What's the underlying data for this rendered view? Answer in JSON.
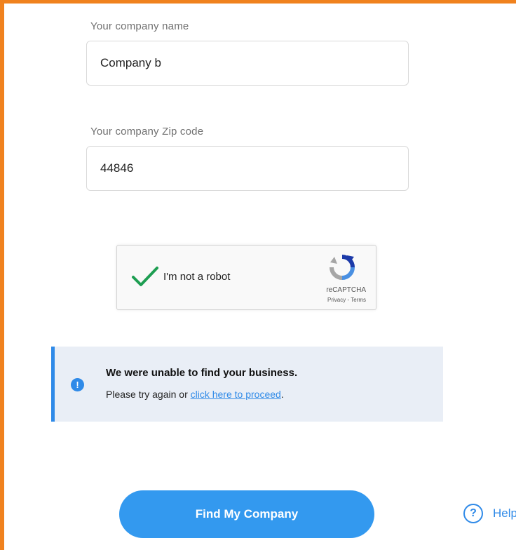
{
  "form": {
    "company_name": {
      "label": "Your company name",
      "value": "Company b"
    },
    "zip_code": {
      "label": "Your company Zip code",
      "value": "44846"
    }
  },
  "captcha": {
    "label": "I'm not a robot",
    "brand": "reCAPTCHA",
    "links": "Privacy - Terms",
    "checked": true
  },
  "alert": {
    "title": "We were unable to find your business.",
    "message_prefix": "Please try again or ",
    "link_text": "click here to proceed",
    "message_suffix": ".",
    "icon": "exclamation-icon"
  },
  "actions": {
    "find_label": "Find My Company",
    "help_label": "Help"
  },
  "colors": {
    "frame_border": "#f0821e",
    "primary": "#3399ef",
    "alert_bg": "#e9eef6",
    "check_green": "#1e9e52"
  }
}
